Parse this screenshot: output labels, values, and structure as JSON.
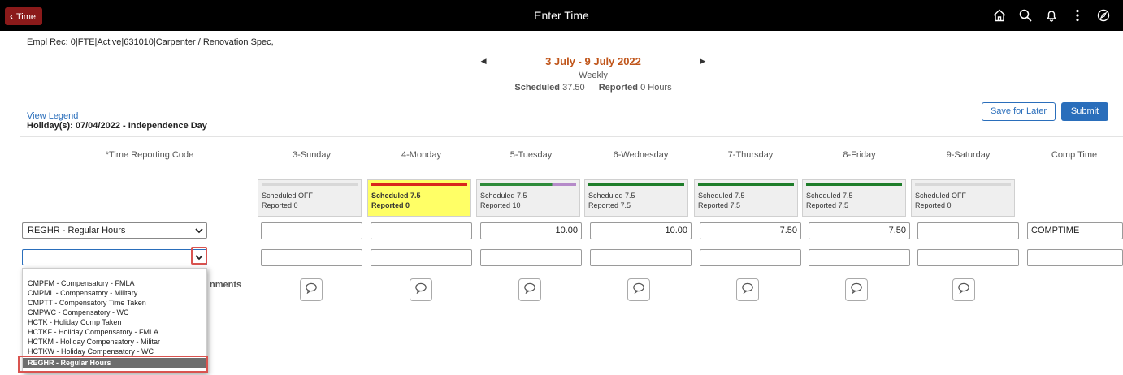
{
  "header": {
    "back_label": "Time",
    "title": "Enter Time",
    "icons": [
      "home-icon",
      "search-icon",
      "bell-icon",
      "more-vertical-icon",
      "compass-icon"
    ]
  },
  "empl_rec": "Empl Rec: 0|FTE|Active|631010|Carpenter / Renovation Spec,",
  "period": {
    "date_range": "3 July - 9 July 2022",
    "frequency": "Weekly",
    "scheduled_label": "Scheduled",
    "scheduled_value": "37.50",
    "reported_label": "Reported",
    "reported_value": "0 Hours"
  },
  "view_legend": "View Legend",
  "holiday": "Holiday(s): 07/04/2022 - Independence Day",
  "buttons": {
    "save_later": "Save for Later",
    "submit": "Submit"
  },
  "columns": {
    "trc": "*Time Reporting Code",
    "days": [
      "3-Sunday",
      "4-Monday",
      "5-Tuesday",
      "6-Wednesday",
      "7-Thursday",
      "8-Friday",
      "9-Saturday"
    ],
    "comp": "Comp Time"
  },
  "day_summaries": [
    {
      "scheduled": "Scheduled OFF",
      "reported": "Reported  0",
      "bar_color": "#d8d8d8",
      "bg": "#efefef",
      "bold": false
    },
    {
      "scheduled": "Scheduled 7.5",
      "reported": "Reported  0",
      "bar_color": "#d9261c",
      "bg": "#ffff66",
      "bold": true
    },
    {
      "scheduled": "Scheduled 7.5",
      "reported": "Reported  10",
      "bar_color": "#2e8b3a",
      "bg": "#efefef",
      "bold": false,
      "bar_extra": "#b58ac9"
    },
    {
      "scheduled": "Scheduled 7.5",
      "reported": "Reported  7.5",
      "bar_color": "#1e7d2a",
      "bg": "#efefef",
      "bold": false
    },
    {
      "scheduled": "Scheduled 7.5",
      "reported": "Reported  7.5",
      "bar_color": "#1e7d2a",
      "bg": "#efefef",
      "bold": false
    },
    {
      "scheduled": "Scheduled 7.5",
      "reported": "Reported  7.5",
      "bar_color": "#1e7d2a",
      "bg": "#efefef",
      "bold": false
    },
    {
      "scheduled": "Scheduled OFF",
      "reported": "Reported  0",
      "bar_color": "#d8d8d8",
      "bg": "#efefef",
      "bold": false
    }
  ],
  "rows": [
    {
      "trc": "REGHR - Regular Hours",
      "values": [
        "",
        "",
        "10.00",
        "10.00",
        "7.50",
        "7.50",
        ""
      ],
      "comp": "COMPTIME"
    },
    {
      "trc": "",
      "values": [
        "",
        "",
        "",
        "",
        "",
        "",
        ""
      ],
      "comp": ""
    }
  ],
  "comments_label": "nments",
  "dropdown_options": [
    "CMPFM - Compensatory - FMLA",
    "CMPML - Compensatory - Military",
    "CMPTT - Compensatory Time Taken",
    "CMPWC - Compensatory - WC",
    "HCTK - Holiday Comp Taken",
    "HCTKF - Holiday Compensatory - FMLA",
    "HCTKM - Holiday Compensatory - Militar",
    "HCTKW - Holiday Compensatory - WC",
    "REGHR - Regular Hours"
  ]
}
